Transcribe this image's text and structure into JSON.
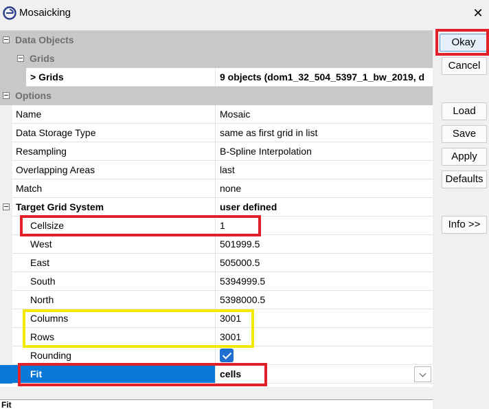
{
  "window": {
    "title": "Mosaicking",
    "icon": "app-logo-icon",
    "close_icon": "close-icon"
  },
  "sections": {
    "data_objects": "Data Objects",
    "grids_group": "Grids",
    "options": "Options"
  },
  "grids_row": {
    "label": "> Grids",
    "value": "9 objects (dom1_32_504_5397_1_bw_2019, d"
  },
  "options": [
    {
      "label": "Name",
      "value": "Mosaic"
    },
    {
      "label": "Data Storage Type",
      "value": "same as first grid in list"
    },
    {
      "label": "Resampling",
      "value": "B-Spline Interpolation"
    },
    {
      "label": "Overlapping Areas",
      "value": "last"
    },
    {
      "label": "Match",
      "value": "none"
    }
  ],
  "target_grid_system": {
    "label": "Target Grid System",
    "value": "user defined",
    "fields": [
      {
        "label": "Cellsize",
        "value": "1"
      },
      {
        "label": "West",
        "value": "501999.5"
      },
      {
        "label": "East",
        "value": "505000.5"
      },
      {
        "label": "South",
        "value": "5394999.5"
      },
      {
        "label": "North",
        "value": "5398000.5"
      },
      {
        "label": "Columns",
        "value": "3001"
      },
      {
        "label": "Rows",
        "value": "3001"
      }
    ],
    "rounding": {
      "label": "Rounding",
      "checked": true
    },
    "fit": {
      "label": "Fit",
      "value": "cells"
    }
  },
  "status_text": "Fit",
  "buttons": {
    "okay": "Okay",
    "cancel": "Cancel",
    "load": "Load",
    "save": "Save",
    "apply": "Apply",
    "defaults": "Defaults",
    "info": "Info >>"
  },
  "colors": {
    "selection": "#0a78d7",
    "highlight_red": "#e3202a",
    "highlight_yellow": "#f3ea00",
    "checkbox": "#1f6fd1"
  }
}
